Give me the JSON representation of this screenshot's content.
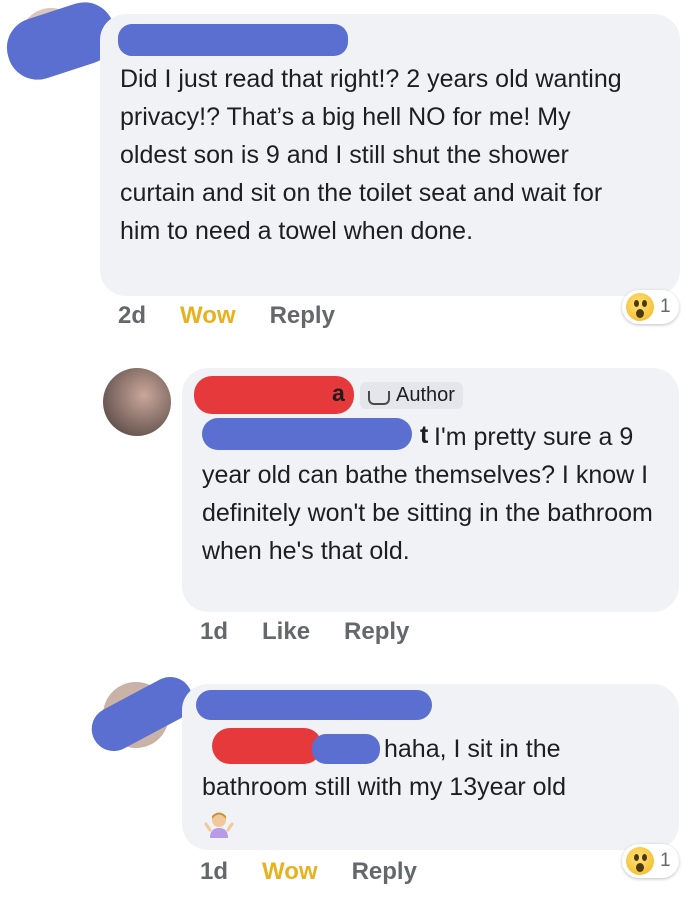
{
  "comments": [
    {
      "text": "Did I just read that right!? 2 years old wanting privacy!? That’s a big hell NO for me! My oldest son is 9 and I still shut the shower curtain and sit on the toilet seat and wait for him to need a towel when done.",
      "time": "2d",
      "reaction_label": "Wow",
      "reply_label": "Reply",
      "reaction_count": "1"
    },
    {
      "badge": "Author",
      "name_suffix": "a",
      "mention_suffix": "t",
      "text": "I'm pretty sure a 9 year old can bathe themselves? I know I definitely won't be sitting in the bathroom when he's that old.",
      "time": "1d",
      "reaction_label": "Like",
      "reply_label": "Reply"
    },
    {
      "text_line1": "haha, I sit in the",
      "text_line2": "bathroom still with my 13year old",
      "time": "1d",
      "reaction_label": "Wow",
      "reply_label": "Reply",
      "reaction_count": "1"
    }
  ],
  "colors": {
    "bubble": "#f0f2f5",
    "wow_label": "#e8b21f",
    "redact_blue": "#5a6fd0",
    "redact_red": "#e6393c"
  },
  "icons": {
    "reaction": "wow-emoji",
    "author_badge": "coffee-icon",
    "emoji": "person-shrugging-emoji"
  }
}
